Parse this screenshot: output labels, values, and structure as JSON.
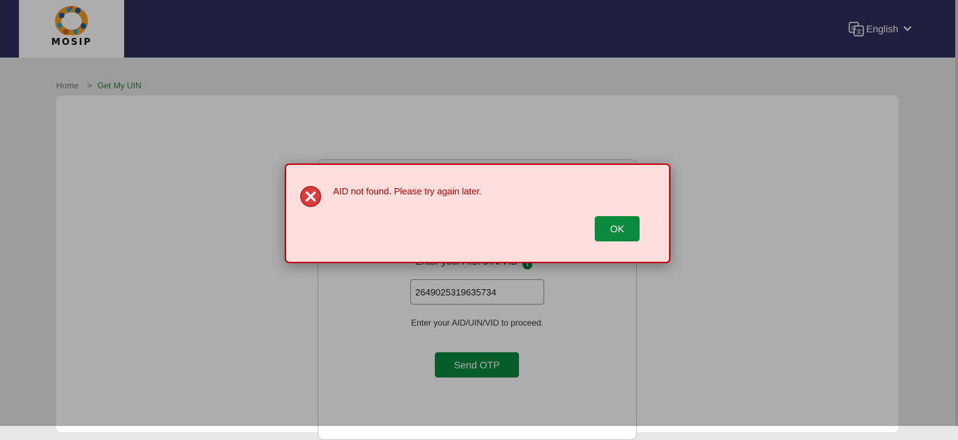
{
  "header": {
    "logo_text": "MOSIP",
    "language": "English",
    "background_color": "#2f2f5f"
  },
  "breadcrumb": {
    "home": "Home",
    "separator": ">",
    "current": "Get My UIN"
  },
  "form": {
    "field_label": "Enter your AID/UIN/VID",
    "info_icon": "info-icon",
    "input_value": "2649025319635734",
    "hint": "Enter your AID/UIN/VID to proceed.",
    "send_otp_label": "Send OTP",
    "accent_color": "#0a8a3d"
  },
  "dialog": {
    "icon": "error-icon",
    "message": "AID not found. Please try again later.",
    "ok_label": "OK",
    "border_color": "#c30000",
    "background_color": "#ffdedd"
  }
}
